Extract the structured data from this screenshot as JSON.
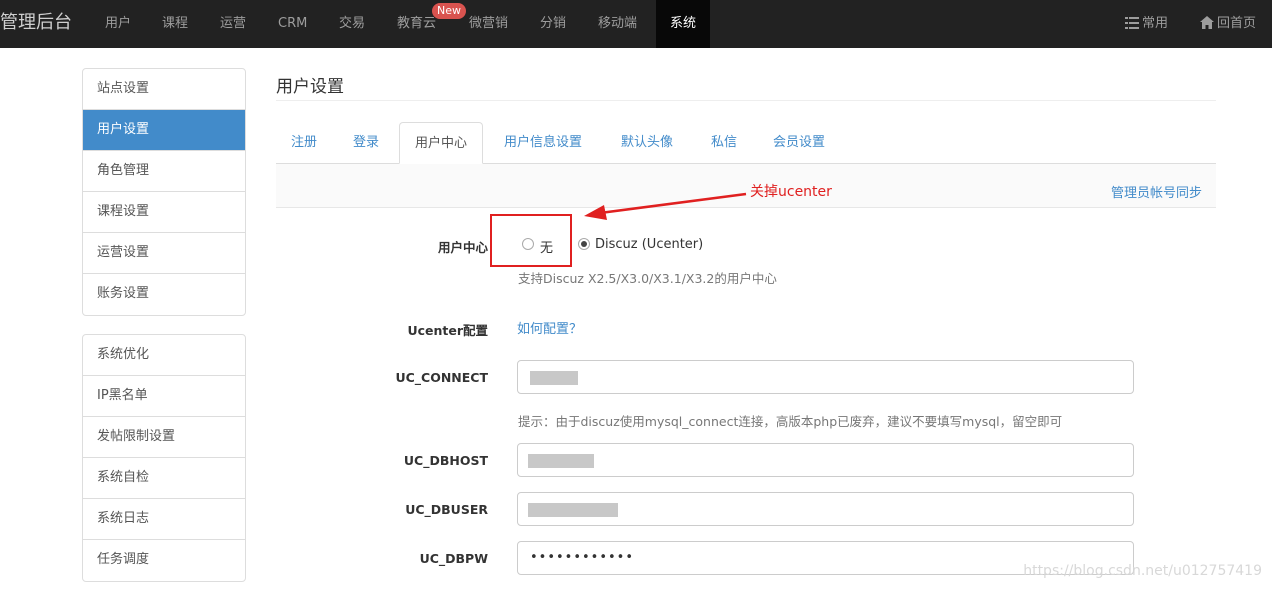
{
  "topbar": {
    "brand": "管理后台",
    "nav": [
      "用户",
      "课程",
      "运营",
      "CRM",
      "交易",
      "教育云",
      "微营销",
      "分销",
      "移动端",
      "系统"
    ],
    "new_badge": "New",
    "common": "常用",
    "home": "回首页"
  },
  "sidebar": {
    "group1": [
      "站点设置",
      "用户设置",
      "角色管理",
      "课程设置",
      "运营设置",
      "账务设置"
    ],
    "group2": [
      "系统优化",
      "IP黑名单",
      "发帖限制设置",
      "系统自检",
      "系统日志",
      "任务调度"
    ]
  },
  "main": {
    "title": "用户设置",
    "tabs": [
      "注册",
      "登录",
      "用户中心",
      "用户信息设置",
      "默认头像",
      "私信",
      "会员设置"
    ],
    "sync_link": "管理员帐号同步",
    "annotation": "关掉ucenter",
    "user_center_label": "用户中心",
    "radio_none": "无",
    "radio_discuz": "Discuz (Ucenter)",
    "support_text": "支持Discuz X2.5/X3.0/X3.1/X3.2的用户中心",
    "ucenter_label": "Ucenter配置",
    "how_config": "如何配置？",
    "uc_connect_label": "UC_CONNECT",
    "uc_connect_hint": "提示：由于discuz使用mysql_connect连接，高版本php已废弃，建议不要填写mysql，留空即可",
    "uc_dbhost_label": "UC_DBHOST",
    "uc_dbuser_label": "UC_DBUSER",
    "uc_dbpw_label": "UC_DBPW",
    "uc_dbpw_value": "••••••••••••"
  },
  "watermark": "https://blog.csdn.net/u012757419",
  "colors": {
    "accent": "#428bca",
    "annotation": "#e02020",
    "topbar": "#222222"
  }
}
